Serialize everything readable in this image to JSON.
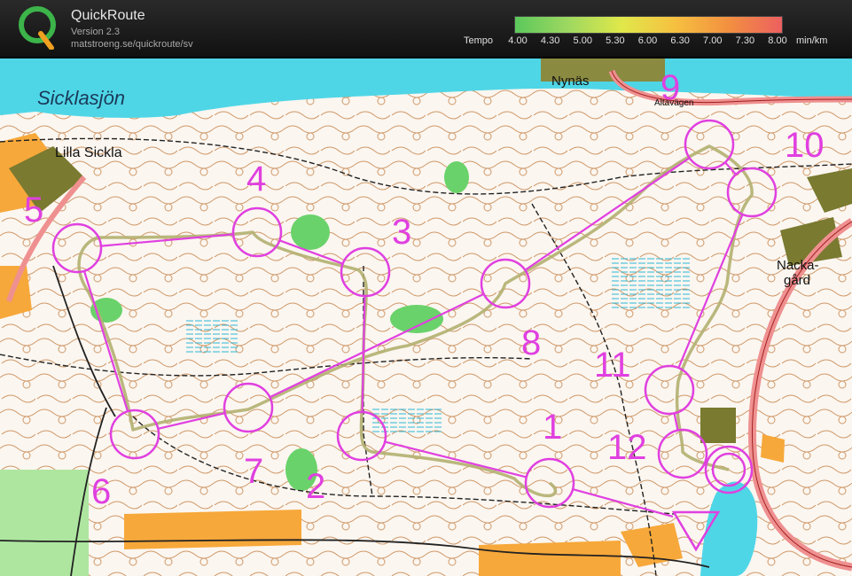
{
  "app": {
    "name": "QuickRoute",
    "version": "Version 2.3",
    "url": "matstroeng.se/quickroute/sv"
  },
  "legend": {
    "prefix": "Tempo",
    "ticks": [
      "4.00",
      "4.30",
      "5.00",
      "5.30",
      "6.00",
      "6.30",
      "7.00",
      "7.30",
      "8.00"
    ],
    "unit": "min/km",
    "colors": [
      "#5cc85c",
      "#9ed860",
      "#e0e84a",
      "#f6c040",
      "#f29040",
      "#ec6060"
    ]
  },
  "map": {
    "colors": {
      "forest": "#ffffff",
      "water": "#4fd6e6",
      "open_land": "#f7a83a",
      "green": "#6ad26a",
      "contours": "#b4682a",
      "tracks": "#222222",
      "course": "#e040e0",
      "route": "#b3b070"
    },
    "place_names": [
      {
        "id": "sicklasjon",
        "text": "Sicklasjön"
      },
      {
        "id": "lilla-sickla",
        "text": "Lilla Sickla"
      },
      {
        "id": "nynas",
        "text": "Nynäs"
      },
      {
        "id": "altavagen",
        "text": "Altavägen"
      },
      {
        "id": "nacka-gard",
        "text": "Nacka-"
      },
      {
        "id": "nacka-gard-2",
        "text": "gård"
      }
    ],
    "controls": [
      {
        "number": "1"
      },
      {
        "number": "2"
      },
      {
        "number": "3"
      },
      {
        "number": "4"
      },
      {
        "number": "5"
      },
      {
        "number": "6"
      },
      {
        "number": "7"
      },
      {
        "number": "8"
      },
      {
        "number": "9"
      },
      {
        "number": "10"
      },
      {
        "number": "11"
      },
      {
        "number": "12"
      }
    ]
  }
}
